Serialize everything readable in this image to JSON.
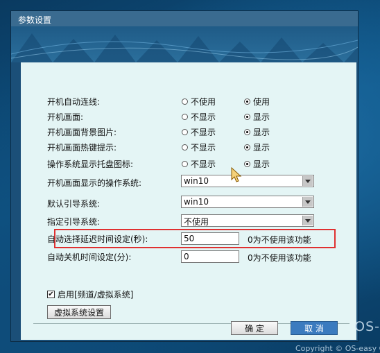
{
  "window": {
    "title": "参数设置"
  },
  "settings": {
    "auto_connect": {
      "label": "开机自动连线:",
      "options": [
        "不使用",
        "使用"
      ],
      "selected": 1
    },
    "boot_screen": {
      "label": "开机画面:",
      "options": [
        "不显示",
        "显示"
      ],
      "selected": 1
    },
    "boot_bg": {
      "label": "开机画面背景图片:",
      "options": [
        "不显示",
        "显示"
      ],
      "selected": 1
    },
    "boot_hotkey": {
      "label": "开机画面热键提示:",
      "options": [
        "不显示",
        "显示"
      ],
      "selected": 1
    },
    "tray_icon": {
      "label": "操作系统显示托盘图标:",
      "options": [
        "不显示",
        "显示"
      ],
      "selected": 1
    },
    "boot_os": {
      "label": "开机画面显示的操作系统:",
      "value": "win10"
    },
    "default_boot": {
      "label": "默认引导系统:",
      "value": "win10"
    },
    "assigned_boot": {
      "label": "指定引导系统:",
      "value": "不使用"
    },
    "auto_select_delay": {
      "label": "自动选择延迟时间设定(秒):",
      "value": "50",
      "hint": "0为不使用该功能"
    },
    "auto_shutdown": {
      "label": "自动关机时间设定(分):",
      "value": "0",
      "hint": "0为不使用该功能"
    }
  },
  "enable_channel": {
    "label": "启用[频道/虚拟系统]",
    "checked": true
  },
  "buttons": {
    "virtual_settings": "虚拟系统设置",
    "ok": "确 定",
    "cancel": "取 消"
  },
  "background": {
    "watermark": "OS-",
    "copyright": "Copyright © OS-easy C"
  },
  "colors": {
    "highlight": "#e03030",
    "primary_button": "#3b7bbf",
    "panel": "#e4f5f5"
  }
}
